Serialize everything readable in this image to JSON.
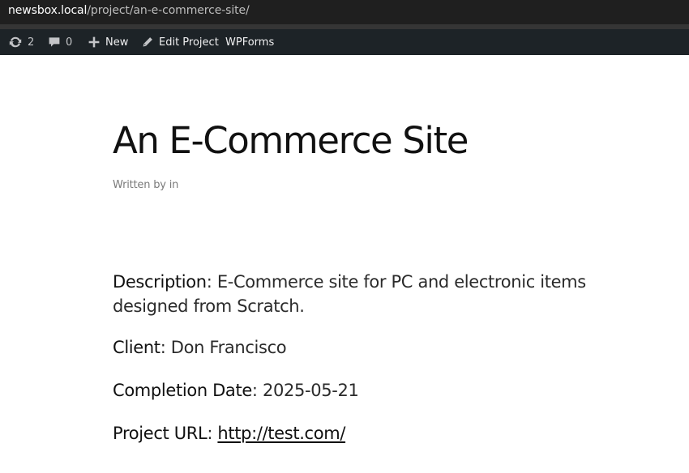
{
  "browser": {
    "url_host": "newsbox.local",
    "url_path": "/project/an-e-commerce-site/"
  },
  "adminbar": {
    "updates_count": "2",
    "comments_count": "0",
    "new_label": "New",
    "edit_label": "Edit Project",
    "wpforms_label": "WPForms"
  },
  "post": {
    "title": "An E-Commerce Site",
    "byline_prefix": "Written by",
    "byline_suffix": "in"
  },
  "details": {
    "description_label": "Description",
    "description_line1": "E-Commerce site for PC and electronic items",
    "description_line2": "designed from Scratch.",
    "client_label": "Client",
    "client_value": "Don Francisco",
    "completion_label": "Completion Date",
    "completion_value": "2025-05-21",
    "url_label": "Project URL",
    "url_value": "http://test.com/"
  },
  "icons": {
    "updates": "refresh-icon",
    "comments": "comment-bubble-icon",
    "new": "plus-icon",
    "edit": "pencil-icon"
  }
}
